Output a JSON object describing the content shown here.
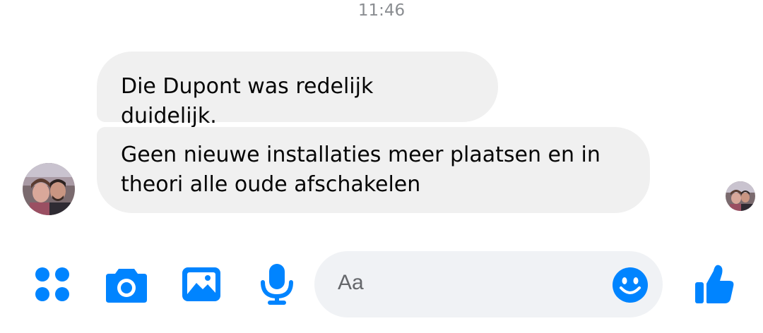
{
  "conversation": {
    "timestamp": "11:46",
    "messages": [
      {
        "text": "Die Dupont was redelijk duidelijk."
      },
      {
        "text": "Geen nieuwe installaties meer plaatsen en in theori alle oude afschakelen"
      }
    ]
  },
  "composer": {
    "placeholder": "Aa",
    "icons": [
      "menu-icon",
      "camera-icon",
      "gallery-icon",
      "microphone-icon",
      "emoji-icon",
      "thumbs-up-icon"
    ],
    "accent_color": "#0084ff"
  }
}
